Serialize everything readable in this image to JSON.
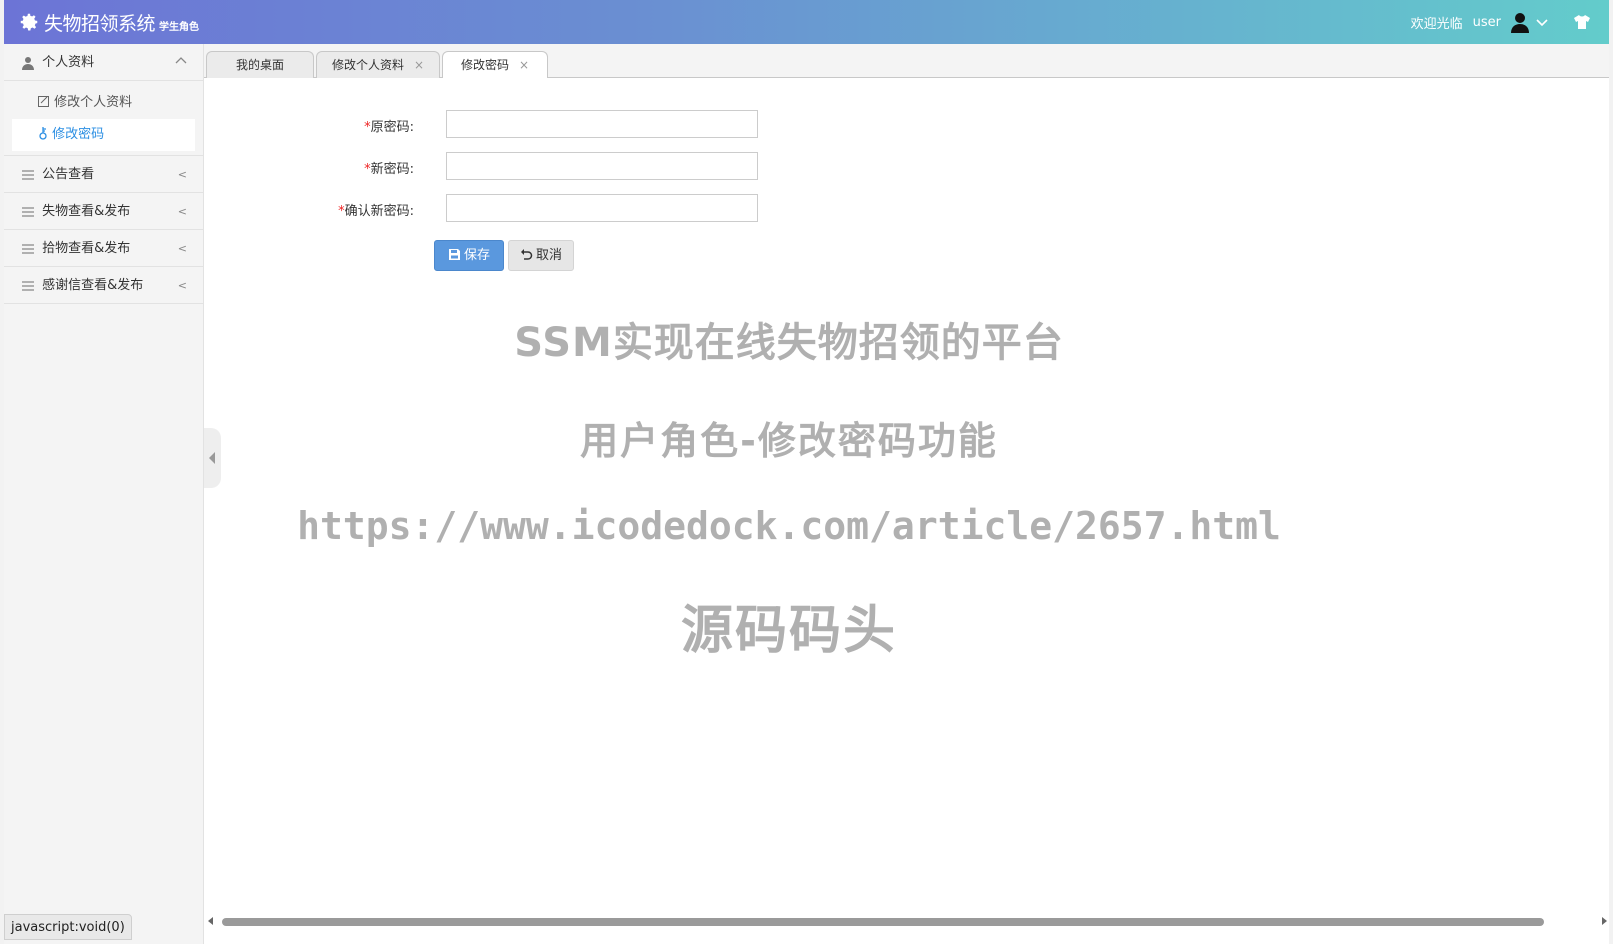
{
  "header": {
    "title": "失物招领系统",
    "subtitle": "学生角色",
    "welcome": "欢迎光临",
    "username": "user"
  },
  "sidebar": {
    "groups": [
      {
        "label": "个人资料",
        "icon": "user-icon",
        "expanded": true,
        "items": [
          {
            "label": "修改个人资料",
            "icon": "edit-icon"
          },
          {
            "label": "修改密码",
            "icon": "key-icon",
            "active": true
          }
        ]
      },
      {
        "label": "公告查看",
        "icon": "menu-icon"
      },
      {
        "label": "失物查看&发布",
        "icon": "menu-icon"
      },
      {
        "label": "拾物查看&发布",
        "icon": "menu-icon"
      },
      {
        "label": "感谢信查看&发布",
        "icon": "menu-icon"
      }
    ]
  },
  "tabs": [
    {
      "label": "我的桌面",
      "closable": false
    },
    {
      "label": "修改个人资料",
      "closable": true,
      "close": "×"
    },
    {
      "label": "修改密码",
      "closable": true,
      "close": "×",
      "active": true
    }
  ],
  "form": {
    "required_mark": "*",
    "fields": [
      {
        "label": "原密码:",
        "value": ""
      },
      {
        "label": "新密码:",
        "value": ""
      },
      {
        "label": "确认新密码:",
        "value": ""
      }
    ],
    "save_label": "保存",
    "cancel_label": "取消"
  },
  "watermark": {
    "line1": "SSM实现在线失物招领的平台",
    "line2": "用户角色-修改密码功能",
    "line3": "https://www.icodedock.com/article/2657.html",
    "line4": "源码码头"
  },
  "status_bar": "javascript:void(0)",
  "colors": {
    "accent": "#2c8fe3",
    "save_button": "#5a98de",
    "header_start": "#6c74d6",
    "header_end": "#63cccb"
  }
}
